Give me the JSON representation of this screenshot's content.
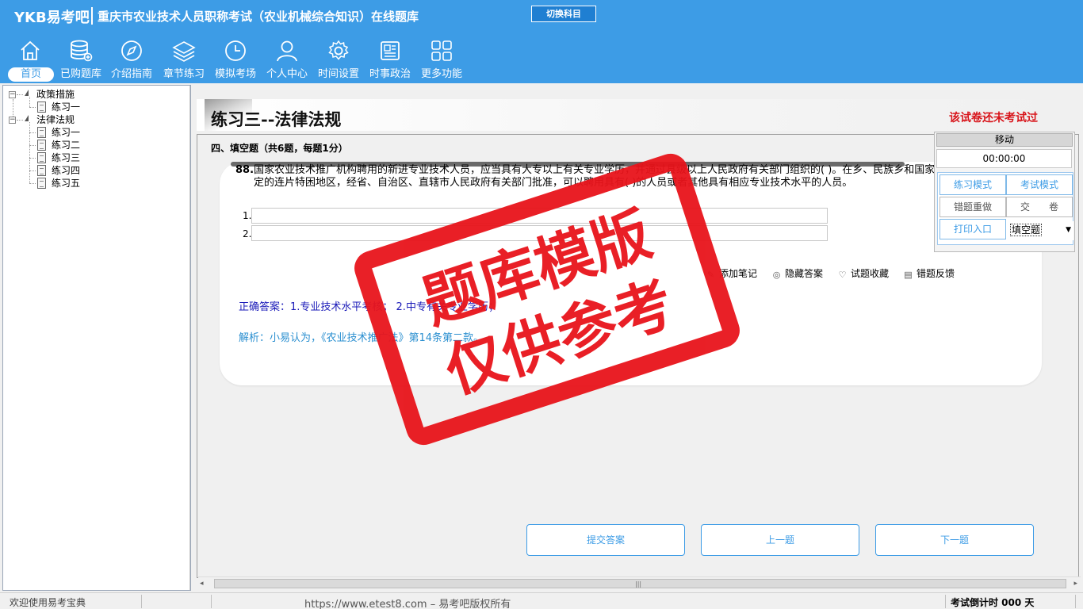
{
  "header": {
    "logo": "YKB易考吧",
    "title": "重庆市农业技术人员职称考试（农业机械综合知识）在线题库",
    "switch_label": "切换科目",
    "nav": [
      {
        "label": "首页",
        "icon": "home-icon"
      },
      {
        "label": "已购题库",
        "icon": "database-icon"
      },
      {
        "label": "介绍指南",
        "icon": "compass-icon"
      },
      {
        "label": "章节练习",
        "icon": "layers-icon"
      },
      {
        "label": "模拟考场",
        "icon": "clock-icon"
      },
      {
        "label": "个人中心",
        "icon": "user-icon"
      },
      {
        "label": "时间设置",
        "icon": "gear-icon"
      },
      {
        "label": "时事政治",
        "icon": "news-icon"
      },
      {
        "label": "更多功能",
        "icon": "grid-icon"
      }
    ]
  },
  "tree": {
    "groups": [
      {
        "label": "政策措施",
        "items": [
          "练习一"
        ]
      },
      {
        "label": "法律法规",
        "items": [
          "练习一",
          "练习二",
          "练习三",
          "练习四",
          "练习五"
        ]
      }
    ]
  },
  "main": {
    "page_title": "练习三--法律法规",
    "exam_status": "该试卷还未考试过",
    "section_head": "四、填空题（共6题，每题1分）",
    "question": {
      "number": "88.",
      "text": "国家农业技术推广机构聘用的新进专业技术人员，应当具有大专以上有关专业学历，并通过县级以上人民政府有关部门组织的( )。在乡、民族乡和国家确定的连片特困地区，经省、自治区、直辖市人民政府有关部门批准，可以聘用具有( )的人员或者其他具有相应专业技术水平的人员。",
      "inputs": [
        {
          "label": "1.",
          "value": ""
        },
        {
          "label": "2.",
          "value": ""
        }
      ]
    },
    "actions": [
      {
        "label": "添加笔记",
        "icon": "pencil-icon"
      },
      {
        "label": "隐藏答案",
        "icon": "eye-icon"
      },
      {
        "label": "试题收藏",
        "icon": "heart-icon"
      },
      {
        "label": "错题反馈",
        "icon": "feedback-icon"
      }
    ],
    "correct_answer": "正确答案：1.专业技术水平考核； 2.中专有关专业学历；",
    "analysis": "解析：小易认为，《农业技术推广法》第14条第二款。",
    "buttons": {
      "submit": "提交答案",
      "prev": "上一题",
      "next": "下一题"
    }
  },
  "float_panel": {
    "move": "移动",
    "timer": "00:00:00",
    "practice_mode": "练习模式",
    "exam_mode": "考试模式",
    "redo_wrong": "错题重做",
    "submit_paper": "交　　卷",
    "print": "打印入口",
    "type_select": "填空题"
  },
  "stamp": {
    "line1": "题库模版",
    "line2": "仅供参考"
  },
  "statusbar": {
    "welcome": "欢迎使用易考宝典",
    "copyright": "https://www.etest8.com – 易考吧版权所有",
    "countdown": "考试倒计时 000 天"
  },
  "colors": {
    "header_bg": "#3d9ce6",
    "accent": "#3d9ce6",
    "alert_red": "#d8141a",
    "stamp_red": "#e8141b",
    "answer_blue": "#1a1ab8",
    "analysis_blue": "#2a8fd0"
  }
}
